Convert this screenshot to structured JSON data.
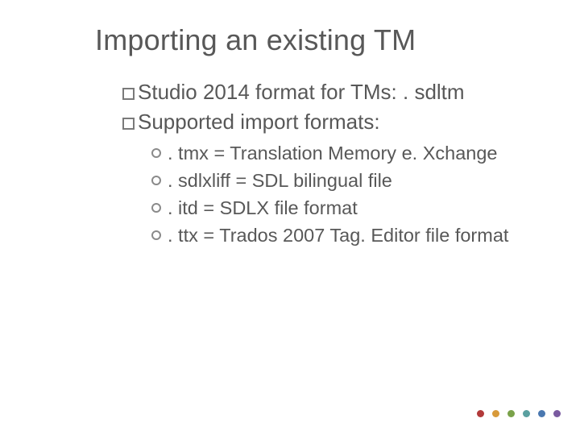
{
  "title": "Importing an existing TM",
  "top_items": [
    "Studio 2014 format for TMs: . sdltm",
    "Supported import formats:"
  ],
  "sub_items": [
    ". tmx = Translation Memory e. Xchange",
    ". sdlxliff = SDL bilingual file",
    ". itd = SDLX file format",
    ". ttx = Trados 2007 Tag. Editor file format"
  ],
  "dot_colors": [
    "red",
    "orange",
    "green",
    "teal",
    "blue",
    "purple"
  ]
}
